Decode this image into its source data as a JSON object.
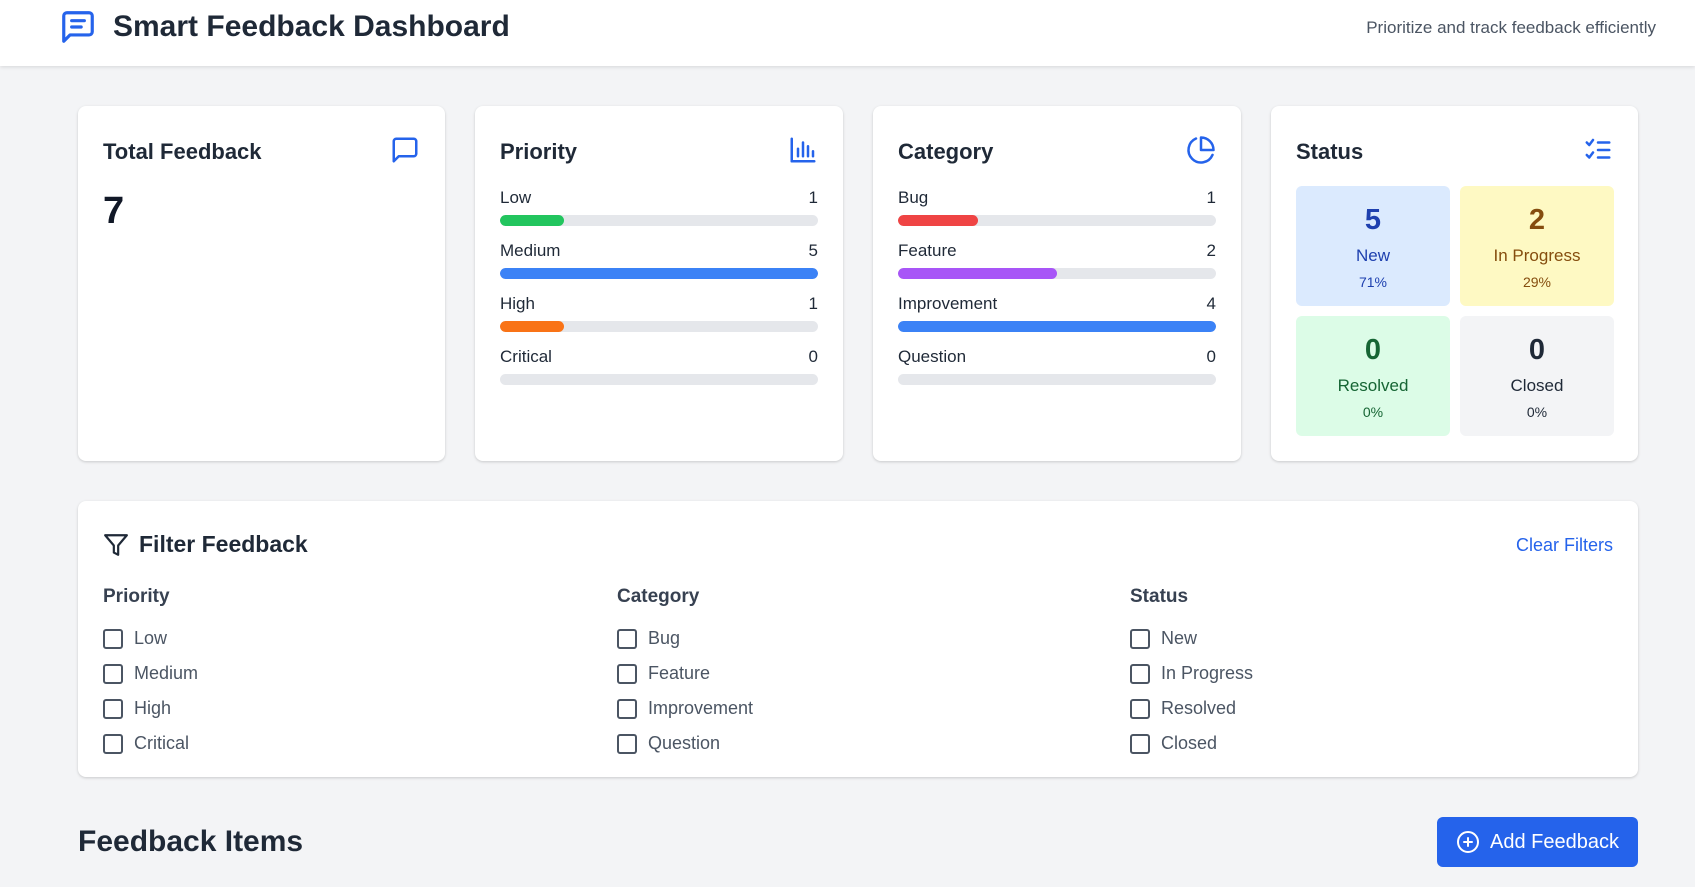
{
  "header": {
    "title": "Smart Feedback Dashboard",
    "tagline": "Prioritize and track feedback efficiently",
    "icon": "message-square-icon"
  },
  "colors": {
    "accent": "#2563eb",
    "bar_track": "#e5e7eb"
  },
  "total_card": {
    "title": "Total Feedback",
    "value": "7",
    "icon": "message-square-icon"
  },
  "priority_card": {
    "title": "Priority",
    "icon": "bar-chart-icon",
    "items": [
      {
        "label": "Low",
        "count": "1",
        "fraction": 0.2,
        "color": "#22c55e"
      },
      {
        "label": "Medium",
        "count": "5",
        "fraction": 1.0,
        "color": "#3b82f6"
      },
      {
        "label": "High",
        "count": "1",
        "fraction": 0.2,
        "color": "#f97316"
      },
      {
        "label": "Critical",
        "count": "0",
        "fraction": 0.0,
        "color": "#ef4444"
      }
    ]
  },
  "category_card": {
    "title": "Category",
    "icon": "pie-chart-icon",
    "items": [
      {
        "label": "Bug",
        "count": "1",
        "fraction": 0.25,
        "color": "#ef4444"
      },
      {
        "label": "Feature",
        "count": "2",
        "fraction": 0.5,
        "color": "#a855f7"
      },
      {
        "label": "Improvement",
        "count": "4",
        "fraction": 1.0,
        "color": "#3b82f6"
      },
      {
        "label": "Question",
        "count": "0",
        "fraction": 0.0,
        "color": "#eab308"
      }
    ]
  },
  "status_card": {
    "title": "Status",
    "icon": "list-checks-icon",
    "tiles": [
      {
        "value": "5",
        "label": "New",
        "percent": "71%",
        "bg": "#dbeafe",
        "fg": "#1e40af"
      },
      {
        "value": "2",
        "label": "In Progress",
        "percent": "29%",
        "bg": "#fef9c3",
        "fg": "#854d0e"
      },
      {
        "value": "0",
        "label": "Resolved",
        "percent": "0%",
        "bg": "#dcfce7",
        "fg": "#166534"
      },
      {
        "value": "0",
        "label": "Closed",
        "percent": "0%",
        "bg": "#f3f4f6",
        "fg": "#1f2937"
      }
    ]
  },
  "filters": {
    "title": "Filter Feedback",
    "icon": "filter-icon",
    "clear_label": "Clear Filters",
    "groups": [
      {
        "title": "Priority",
        "options": [
          "Low",
          "Medium",
          "High",
          "Critical"
        ]
      },
      {
        "title": "Category",
        "options": [
          "Bug",
          "Feature",
          "Improvement",
          "Question"
        ]
      },
      {
        "title": "Status",
        "options": [
          "New",
          "In Progress",
          "Resolved",
          "Closed"
        ]
      }
    ]
  },
  "items_section": {
    "title": "Feedback Items",
    "add_label": "Add Feedback",
    "add_icon": "plus-circle-icon"
  }
}
